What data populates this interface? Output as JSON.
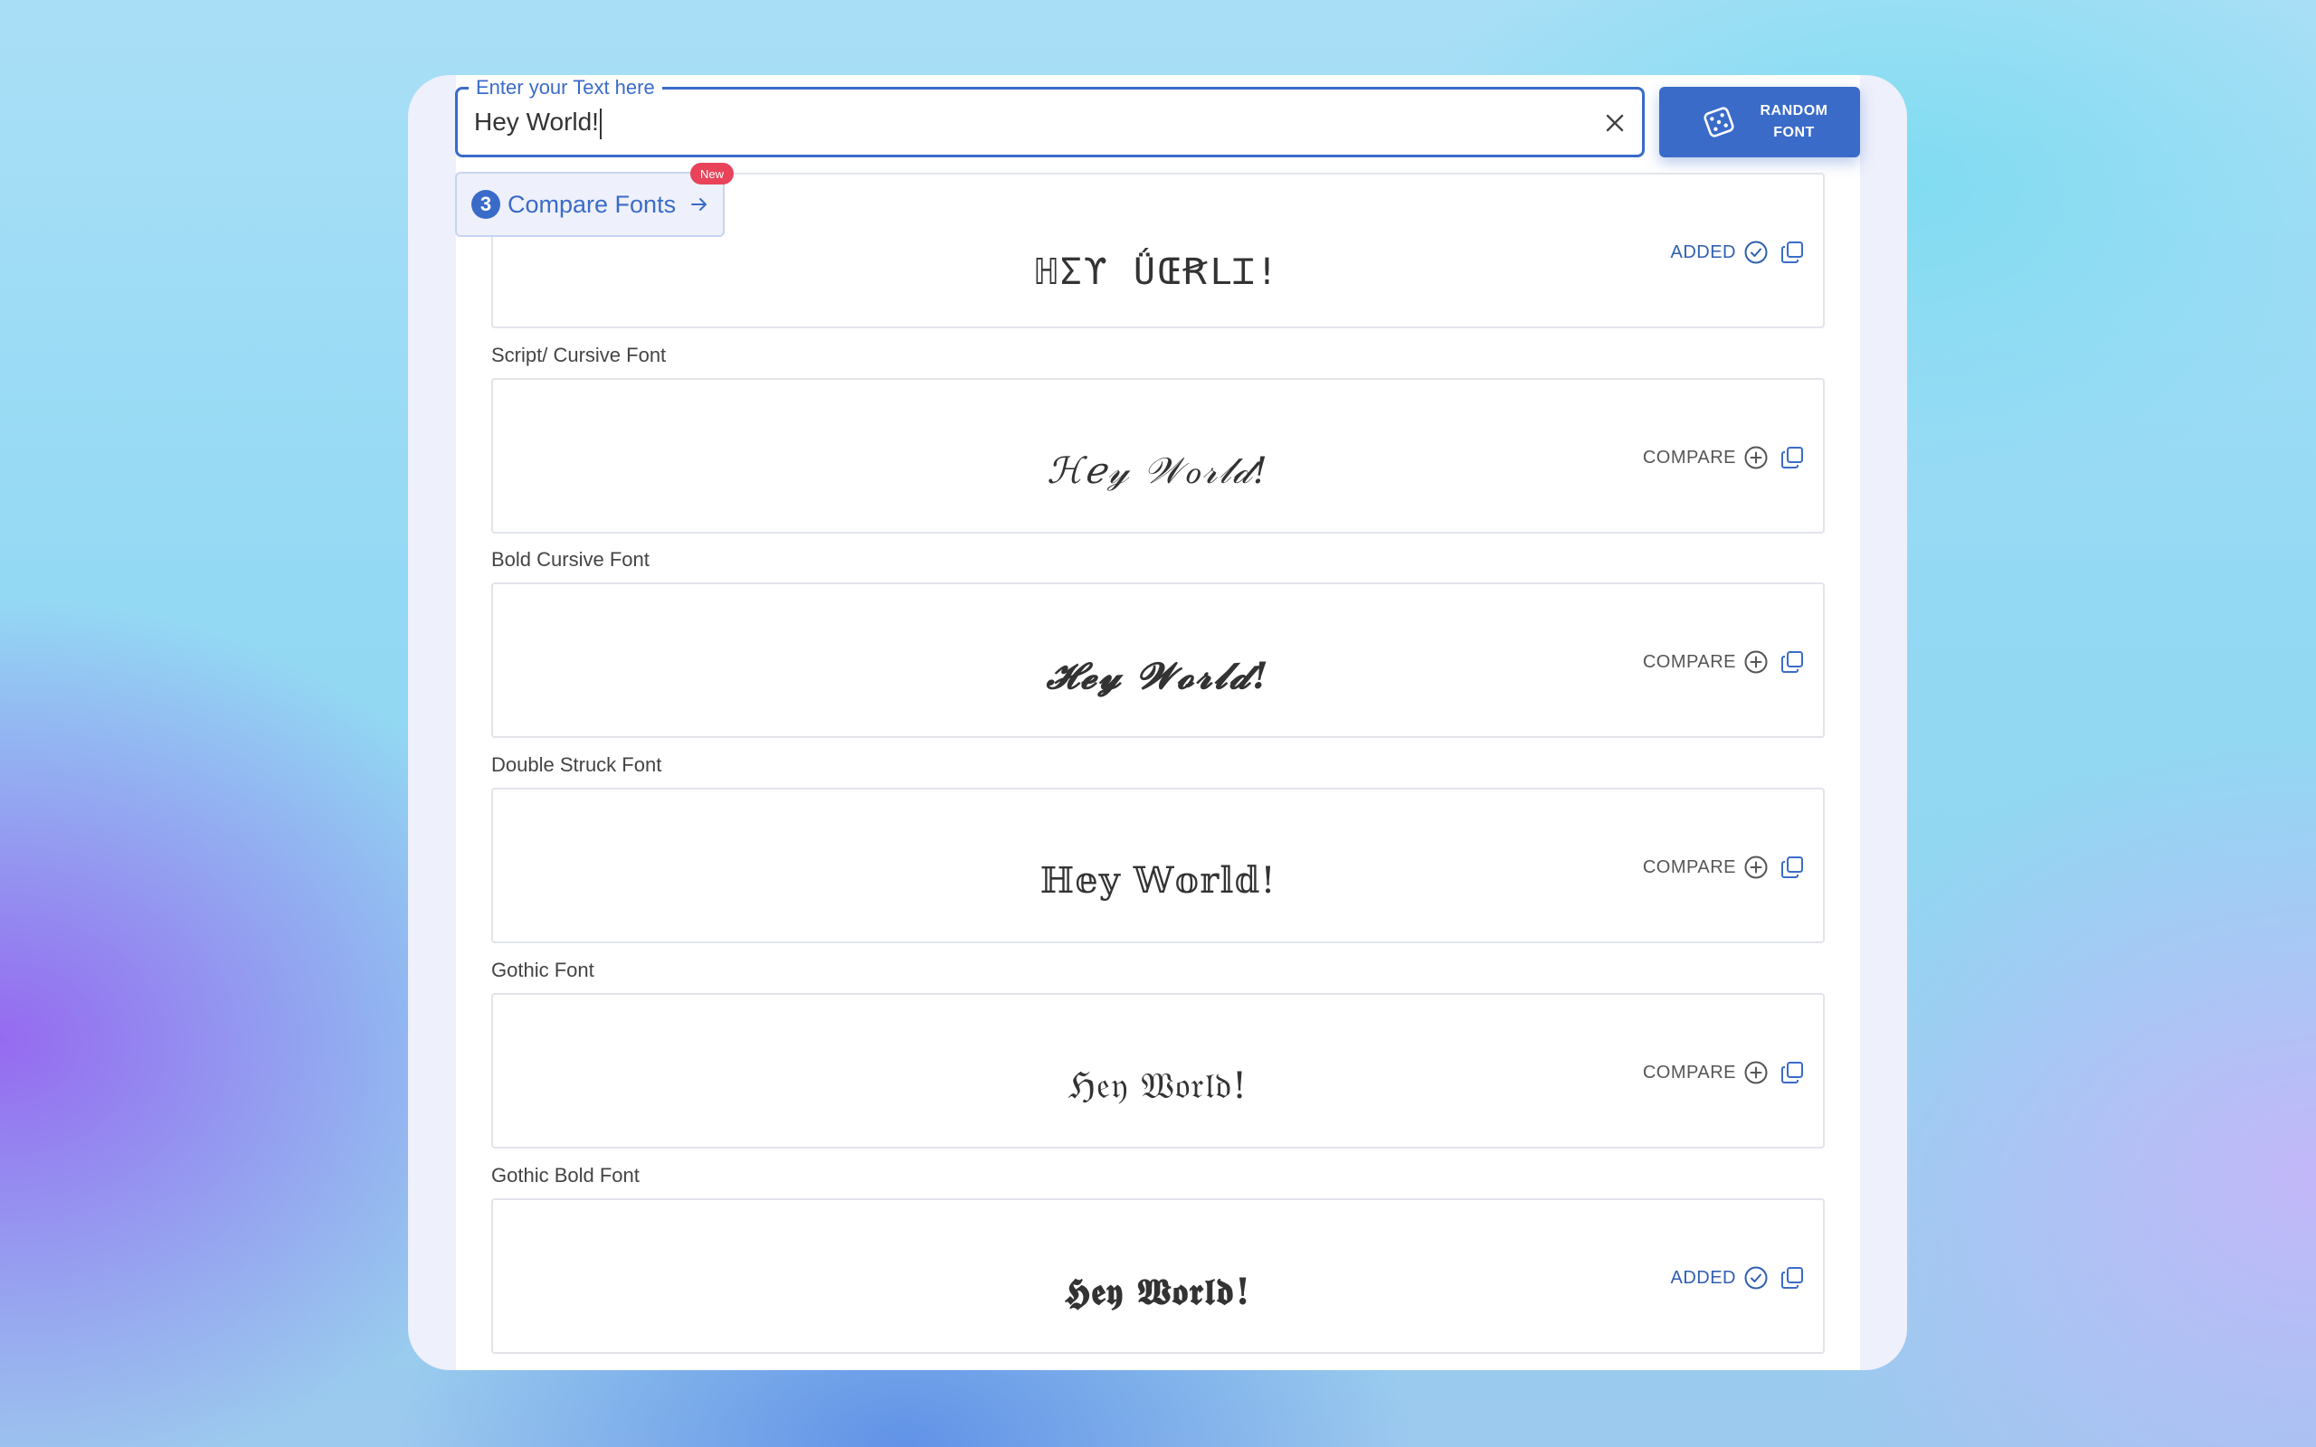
{
  "input": {
    "label": "Enter your Text here",
    "value": "Hey World!"
  },
  "random_button": {
    "line1": "RANDOM",
    "line2": "FONT"
  },
  "compare_pill": {
    "count": "3",
    "label": "Compare Fonts",
    "badge": "New"
  },
  "colors": {
    "accent": "#3a6bc9",
    "badge": "#e8435a"
  },
  "fonts": [
    {
      "title": "",
      "sample": "ℍΣϒ ǗŒꞦⅬꞮ!",
      "status": "ADDED"
    },
    {
      "title": "Script/ Cursive Font",
      "sample": "ℋℯ𝓎 𝒲ℴ𝓇𝓁𝒹!",
      "status": "COMPARE"
    },
    {
      "title": "Bold Cursive Font",
      "sample": "𝓗𝓮𝔂 𝓦𝓸𝓻𝓵𝓭!",
      "status": "COMPARE"
    },
    {
      "title": "Double Struck Font",
      "sample": "ℍ𝕖𝕪 𝕎𝕠𝕣𝕝𝕕!",
      "status": "COMPARE"
    },
    {
      "title": "Gothic Font",
      "sample": "ℌ𝔢𝔶 𝔚𝔬𝔯𝔩𝔡!",
      "status": "COMPARE"
    },
    {
      "title": "Gothic Bold Font",
      "sample": "𝕳𝖊𝖞 𝖂𝖔𝖗𝖑𝖉!",
      "status": "ADDED"
    }
  ]
}
